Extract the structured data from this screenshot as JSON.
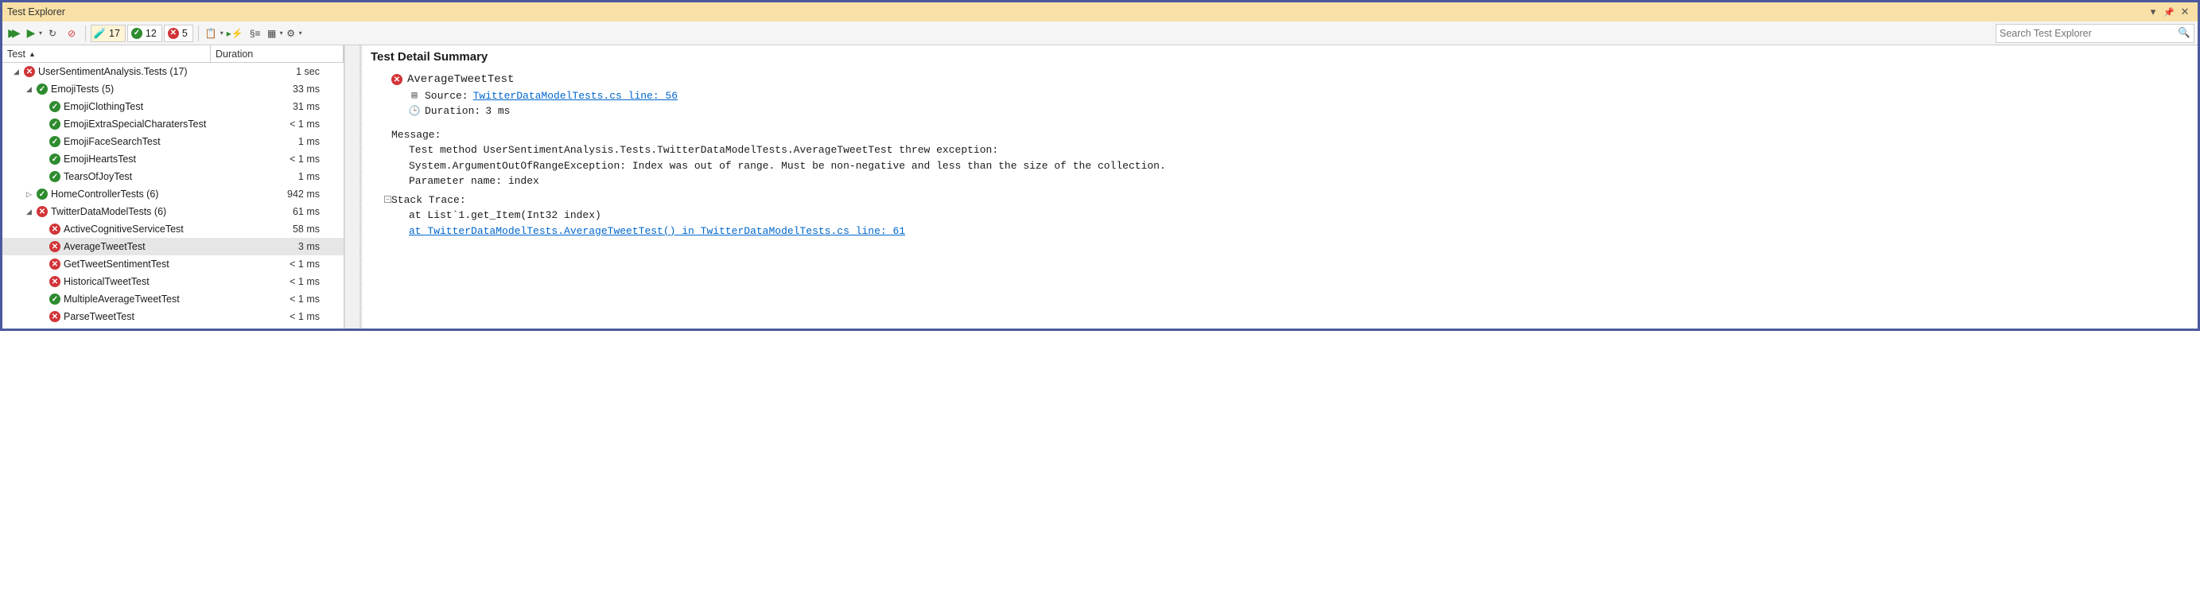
{
  "window": {
    "title": "Test Explorer",
    "search_placeholder": "Search Test Explorer"
  },
  "summary": {
    "total": 17,
    "passed": 12,
    "failed": 5
  },
  "columns": {
    "test": "Test",
    "duration": "Duration"
  },
  "tree": [
    {
      "indent": 0,
      "exp": "open",
      "icon": "fail",
      "label": "UserSentimentAnalysis.Tests  (17)",
      "duration": "1 sec"
    },
    {
      "indent": 1,
      "exp": "open",
      "icon": "pass",
      "label": "EmojiTests  (5)",
      "duration": "33 ms"
    },
    {
      "indent": 2,
      "exp": "none",
      "icon": "pass",
      "label": "EmojiClothingTest",
      "duration": "31 ms"
    },
    {
      "indent": 2,
      "exp": "none",
      "icon": "pass",
      "label": "EmojiExtraSpecialCharatersTest",
      "duration": "< 1 ms"
    },
    {
      "indent": 2,
      "exp": "none",
      "icon": "pass",
      "label": "EmojiFaceSearchTest",
      "duration": "1 ms"
    },
    {
      "indent": 2,
      "exp": "none",
      "icon": "pass",
      "label": "EmojiHeartsTest",
      "duration": "< 1 ms"
    },
    {
      "indent": 2,
      "exp": "none",
      "icon": "pass",
      "label": "TearsOfJoyTest",
      "duration": "1 ms"
    },
    {
      "indent": 1,
      "exp": "closed",
      "icon": "pass",
      "label": "HomeControllerTests  (6)",
      "duration": "942 ms"
    },
    {
      "indent": 1,
      "exp": "open",
      "icon": "fail",
      "label": "TwitterDataModelTests  (6)",
      "duration": "61 ms"
    },
    {
      "indent": 2,
      "exp": "none",
      "icon": "fail",
      "label": "ActiveCognitiveServiceTest",
      "duration": "58 ms"
    },
    {
      "indent": 2,
      "exp": "none",
      "icon": "fail",
      "label": "AverageTweetTest",
      "duration": "3 ms",
      "selected": true
    },
    {
      "indent": 2,
      "exp": "none",
      "icon": "fail",
      "label": "GetTweetSentimentTest",
      "duration": "< 1 ms"
    },
    {
      "indent": 2,
      "exp": "none",
      "icon": "fail",
      "label": "HistoricalTweetTest",
      "duration": "< 1 ms"
    },
    {
      "indent": 2,
      "exp": "none",
      "icon": "pass",
      "label": "MultipleAverageTweetTest",
      "duration": "< 1 ms"
    },
    {
      "indent": 2,
      "exp": "none",
      "icon": "fail",
      "label": "ParseTweetTest",
      "duration": "< 1 ms"
    }
  ],
  "detail": {
    "heading": "Test Detail Summary",
    "test_name": "AverageTweetTest",
    "source_label": "Source:",
    "source_link": "TwitterDataModelTests.cs line: 56",
    "duration_label": "Duration:",
    "duration_value": "3 ms",
    "message_label": "Message:",
    "message_body": "Test method UserSentimentAnalysis.Tests.TwitterDataModelTests.AverageTweetTest threw exception: \nSystem.ArgumentOutOfRangeException: Index was out of range. Must be non-negative and less than the size of the collection.\nParameter name: index",
    "stack_label": "Stack Trace:",
    "stack_line1": "at List`1.get_Item(Int32 index)",
    "stack_link": "at TwitterDataModelTests.AverageTweetTest() in TwitterDataModelTests.cs line: 61"
  }
}
